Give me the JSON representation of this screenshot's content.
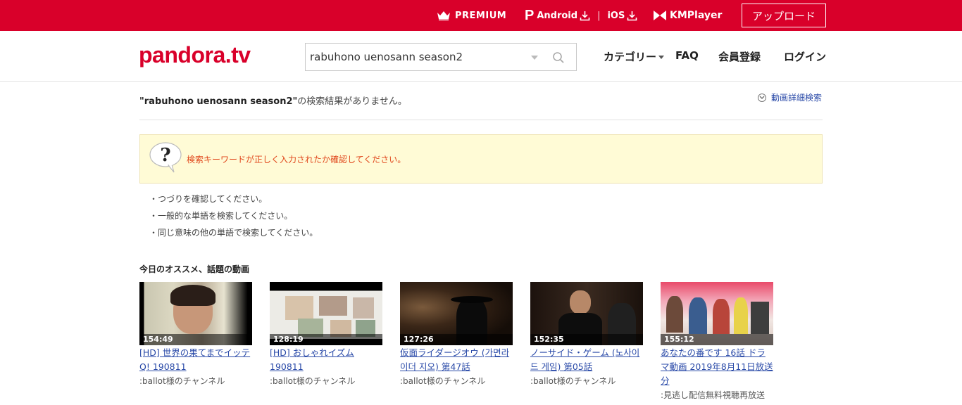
{
  "topbar": {
    "premium": "PREMIUM",
    "android": "Android",
    "separator": "|",
    "ios": "iOS",
    "kmplayer": "KMPlayer",
    "upload": "アップロード",
    "bg_color": "#d9002a"
  },
  "header": {
    "logo": "pandora.tv",
    "search_value": "rabuhono uenosann season2",
    "nav": {
      "category": "カテゴリー",
      "faq": "FAQ",
      "register": "会員登録",
      "login": "ログイン"
    }
  },
  "result": {
    "query": "\"rabuhono uenosann season2\"",
    "message": "の検索結果がありません。",
    "advanced_search": "動画詳細検索"
  },
  "notice": {
    "text": "検索キーワードが正しく入力されたか確認してください。"
  },
  "tips": [
    "つづりを確認してください。",
    "一般的な単語を検索してください。",
    "同じ意味の他の単語で検索してください。"
  ],
  "recommended": {
    "title": "今日のオススメ、話題の動画",
    "videos": [
      {
        "duration": "154:49",
        "title": "[HD] 世界の果てまでイッテQ! 190811",
        "channel": ":ballot様のチャンネル"
      },
      {
        "duration": "128:19",
        "title": "[HD] おしゃれイズム 190811",
        "channel": ":ballot様のチャンネル"
      },
      {
        "duration": "127:26",
        "title": "仮面ライダージオウ (가면라이더 지오) 第47話",
        "channel": ":ballot様のチャンネル"
      },
      {
        "duration": "152:35",
        "title": "ノーサイド・ゲーム (노사이드 게임) 第05話",
        "channel": ":ballot様のチャンネル"
      },
      {
        "duration": "155:12",
        "title": "あなたの番です 16話 ドラマ動画 2019年8月11日放送分",
        "channel": ":見逃し配信無料視聴再放送"
      }
    ]
  }
}
